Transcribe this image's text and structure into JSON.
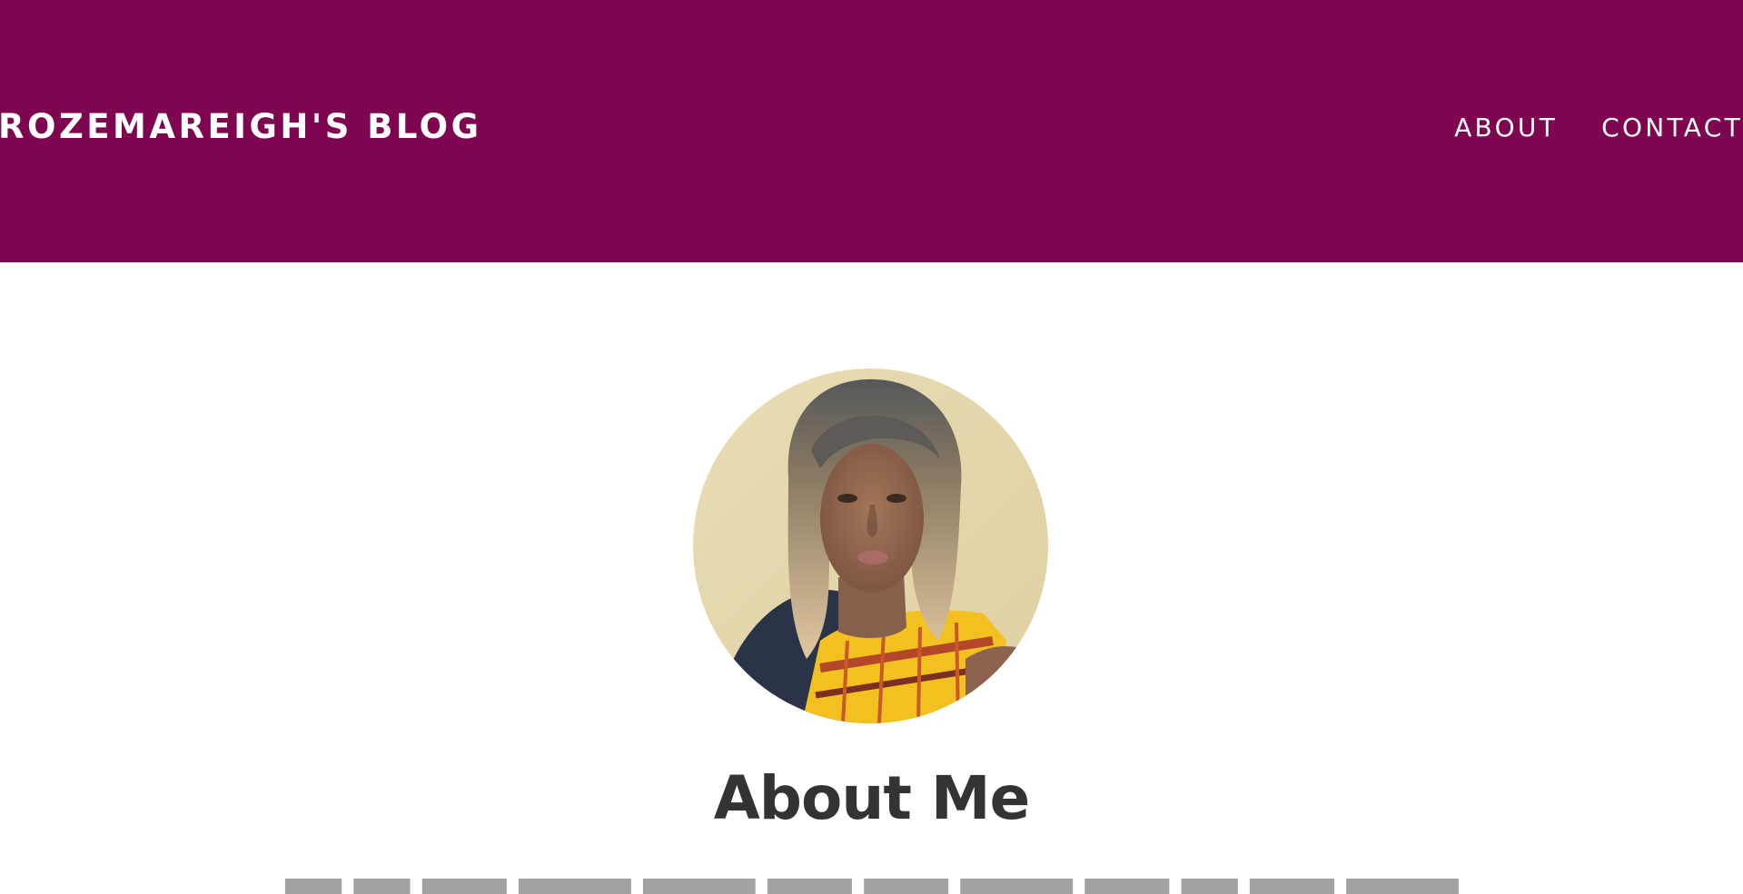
{
  "header": {
    "site_title": "ROZEMAREIGH'S BLOG",
    "background_color": "#7e0650",
    "nav": [
      {
        "label": "ABOUT"
      },
      {
        "label": "CONTACT"
      }
    ]
  },
  "main": {
    "avatar": {
      "description": "profile-photo",
      "alt": "Profile photo"
    },
    "heading": "About Me"
  },
  "colors": {
    "accent": "#7e0650",
    "text": "#333333",
    "background": "#ffffff"
  }
}
